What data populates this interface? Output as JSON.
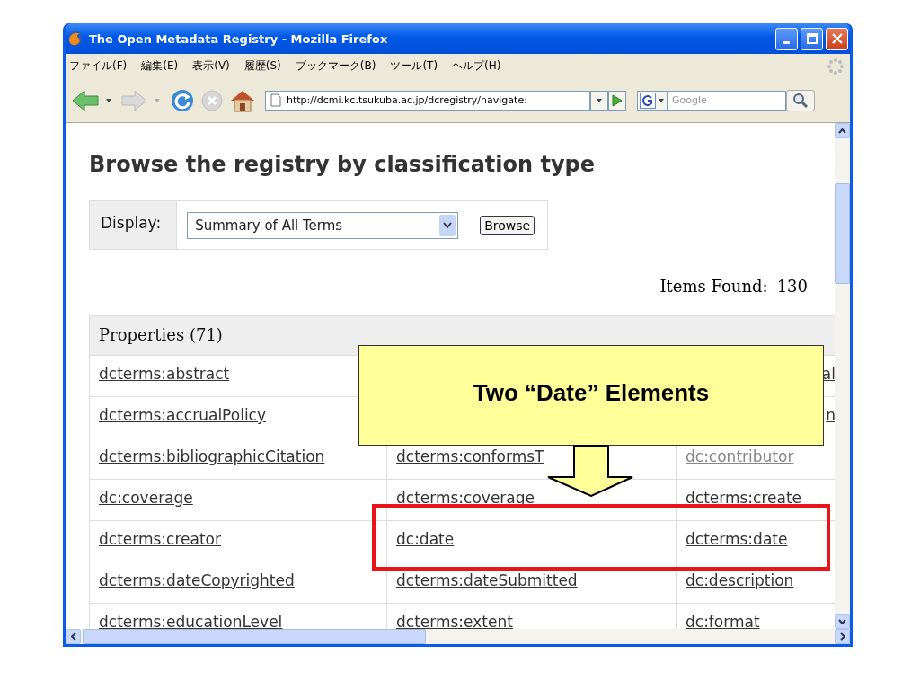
{
  "window": {
    "title": "The Open Metadata Registry - Mozilla Firefox",
    "menu": [
      "ファイル(F)",
      "編集(E)",
      "表示(V)",
      "履歴(S)",
      "ブックマーク(B)",
      "ツール(T)",
      "ヘルプ(H)"
    ],
    "toolbar": {
      "url": "http://dcmi.kc.tsukuba.ac.jp/dcregistry/navigate:",
      "search": {
        "placeholder": "Google"
      }
    }
  },
  "page": {
    "heading": "Browse the registry by classification type",
    "display": {
      "label": "Display:",
      "value": "Summary of All Terms",
      "button": "Browse"
    },
    "items_found": {
      "label": "Items Found:",
      "count": "130"
    },
    "table": {
      "header": "Properties (71)",
      "rows": [
        [
          {
            "text": "dcterms:abstract",
            "visited": false
          },
          null,
          {
            "text": "al",
            "visited": false,
            "kind": "fragment"
          }
        ],
        [
          {
            "text": "dcterms:accrualPolicy",
            "visited": false
          },
          null,
          {
            "text": "n",
            "visited": false,
            "kind": "fragment"
          }
        ],
        [
          {
            "text": "dcterms:bibliographicCitation",
            "visited": false
          },
          {
            "text": "dcterms:conformsT",
            "visited": false
          },
          {
            "text": "dc:contributor",
            "visited": true
          }
        ],
        [
          {
            "text": "dc:coverage",
            "visited": false
          },
          {
            "text": "dcterms:coverage",
            "visited": false
          },
          {
            "text": "dcterms:create",
            "visited": false
          }
        ],
        [
          {
            "text": "dcterms:creator",
            "visited": false
          },
          {
            "text": "dc:date",
            "visited": false
          },
          {
            "text": "dcterms:date",
            "visited": false
          }
        ],
        [
          {
            "text": "dcterms:dateCopyrighted",
            "visited": false
          },
          {
            "text": "dcterms:dateSubmitted",
            "visited": false
          },
          {
            "text": "dc:description",
            "visited": false
          }
        ],
        [
          {
            "text": "dcterms:educationLevel",
            "visited": false
          },
          {
            "text": "dcterms:extent",
            "visited": false
          },
          {
            "text": "dc:format",
            "visited": false
          }
        ]
      ]
    }
  },
  "callout": {
    "text": "Two “Date” Elements"
  }
}
